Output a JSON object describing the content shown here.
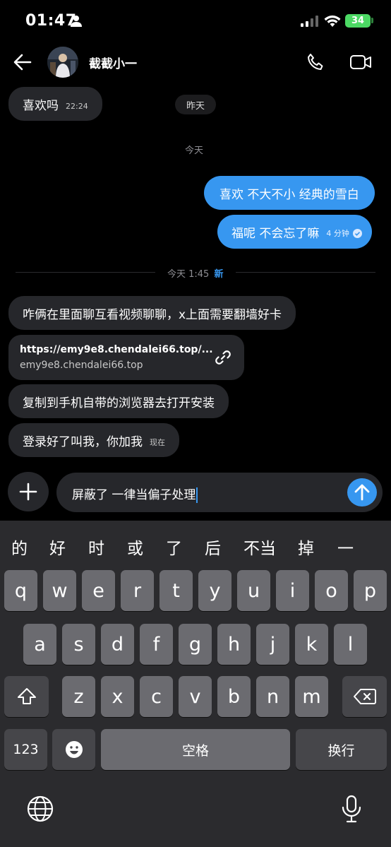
{
  "status_bar": {
    "time": "01:47",
    "battery": "34"
  },
  "header": {
    "contact_name": "截截小一"
  },
  "messages": {
    "m1": {
      "text": "喜欢吗",
      "time": "22:24"
    },
    "date_yesterday": "昨天",
    "date_today": "今天",
    "m2": {
      "text": "喜欢 不大不小 经典的雪白"
    },
    "m3": {
      "text": "福呢 不会忘了嘛",
      "time": "4 分钟"
    },
    "divider": {
      "label": "今天 1:45",
      "new_label": "新"
    },
    "m4": {
      "text": "咋俩在里面聊互看视频聊聊，x上面需要翻墙好卡"
    },
    "link": {
      "url": "https://emy9e8.chendalei66.top/...",
      "host": "emy9e8.chendalei66.top"
    },
    "m5": {
      "text": "复制到手机自带的浏览器去打开安装"
    },
    "m6": {
      "text": "登录好了叫我，你加我",
      "time": "现在"
    }
  },
  "composer": {
    "text": "屏蔽了 一律当偏子处理"
  },
  "keyboard": {
    "candidates": [
      "的",
      "好",
      "时",
      "或",
      "了",
      "后",
      "不当",
      "掉",
      "一"
    ],
    "row1": [
      "q",
      "w",
      "e",
      "r",
      "t",
      "y",
      "u",
      "i",
      "o",
      "p"
    ],
    "row2": [
      "a",
      "s",
      "d",
      "f",
      "g",
      "h",
      "j",
      "k",
      "l"
    ],
    "row3": [
      "z",
      "x",
      "c",
      "v",
      "b",
      "n",
      "m"
    ],
    "numbers_label": "123",
    "space_label": "空格",
    "return_label": "换行"
  },
  "colors": {
    "accent": "#3797f0",
    "bubble_in": "#26272b",
    "background": "#000000",
    "battery": "#4cd964"
  },
  "icons": [
    "person-icon",
    "signal-icon",
    "wifi-icon",
    "back-arrow-icon",
    "phone-icon",
    "video-icon",
    "link-icon",
    "plus-icon",
    "send-arrow-icon",
    "seen-check-icon",
    "shift-icon",
    "delete-icon",
    "emoji-icon",
    "globe-icon",
    "mic-icon"
  ]
}
